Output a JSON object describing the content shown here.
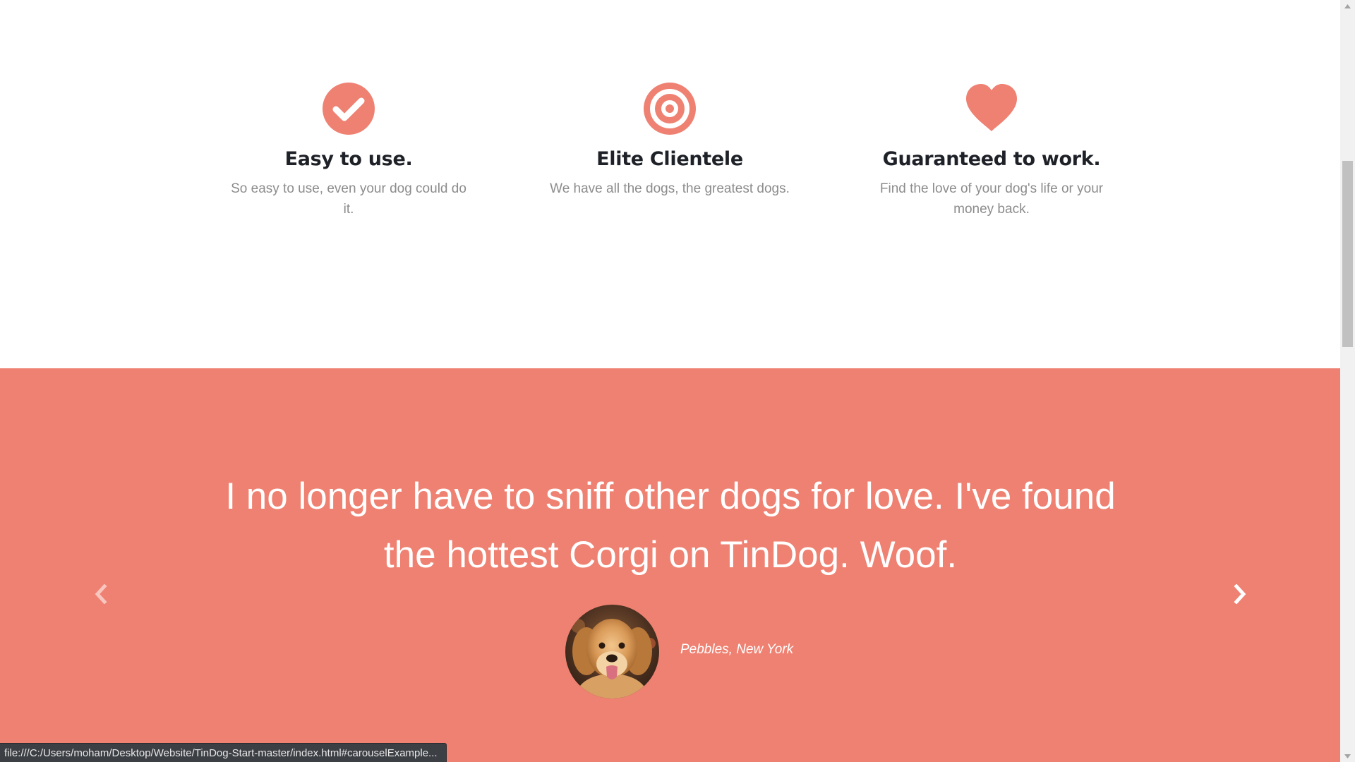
{
  "features": [
    {
      "icon": "check-circle-icon",
      "title": "Easy to use.",
      "description": "So easy to use, even your dog could do it."
    },
    {
      "icon": "bullseye-icon",
      "title": "Elite Clientele",
      "description": "We have all the dogs, the greatest dogs."
    },
    {
      "icon": "heart-icon",
      "title": "Guaranteed to work.",
      "description": "Find the love of your dog's life or your money back."
    }
  ],
  "testimonial": {
    "quote": "I no longer have to sniff other dogs for love. I've found the hottest Corgi on TinDog. Woof.",
    "author": "Pebbles, New York",
    "avatar": "golden-retriever-photo",
    "prev_icon": "chevron-left-icon",
    "next_icon": "chevron-right-icon"
  },
  "status_bar": {
    "url": "file:///C:/Users/moham/Desktop/Website/TinDog-Start-master/index.html#carouselExample..."
  },
  "colors": {
    "accent": "#ef8172",
    "heading": "#1e2127",
    "muted_text": "#8c8c8c",
    "background": "#ffffff"
  }
}
